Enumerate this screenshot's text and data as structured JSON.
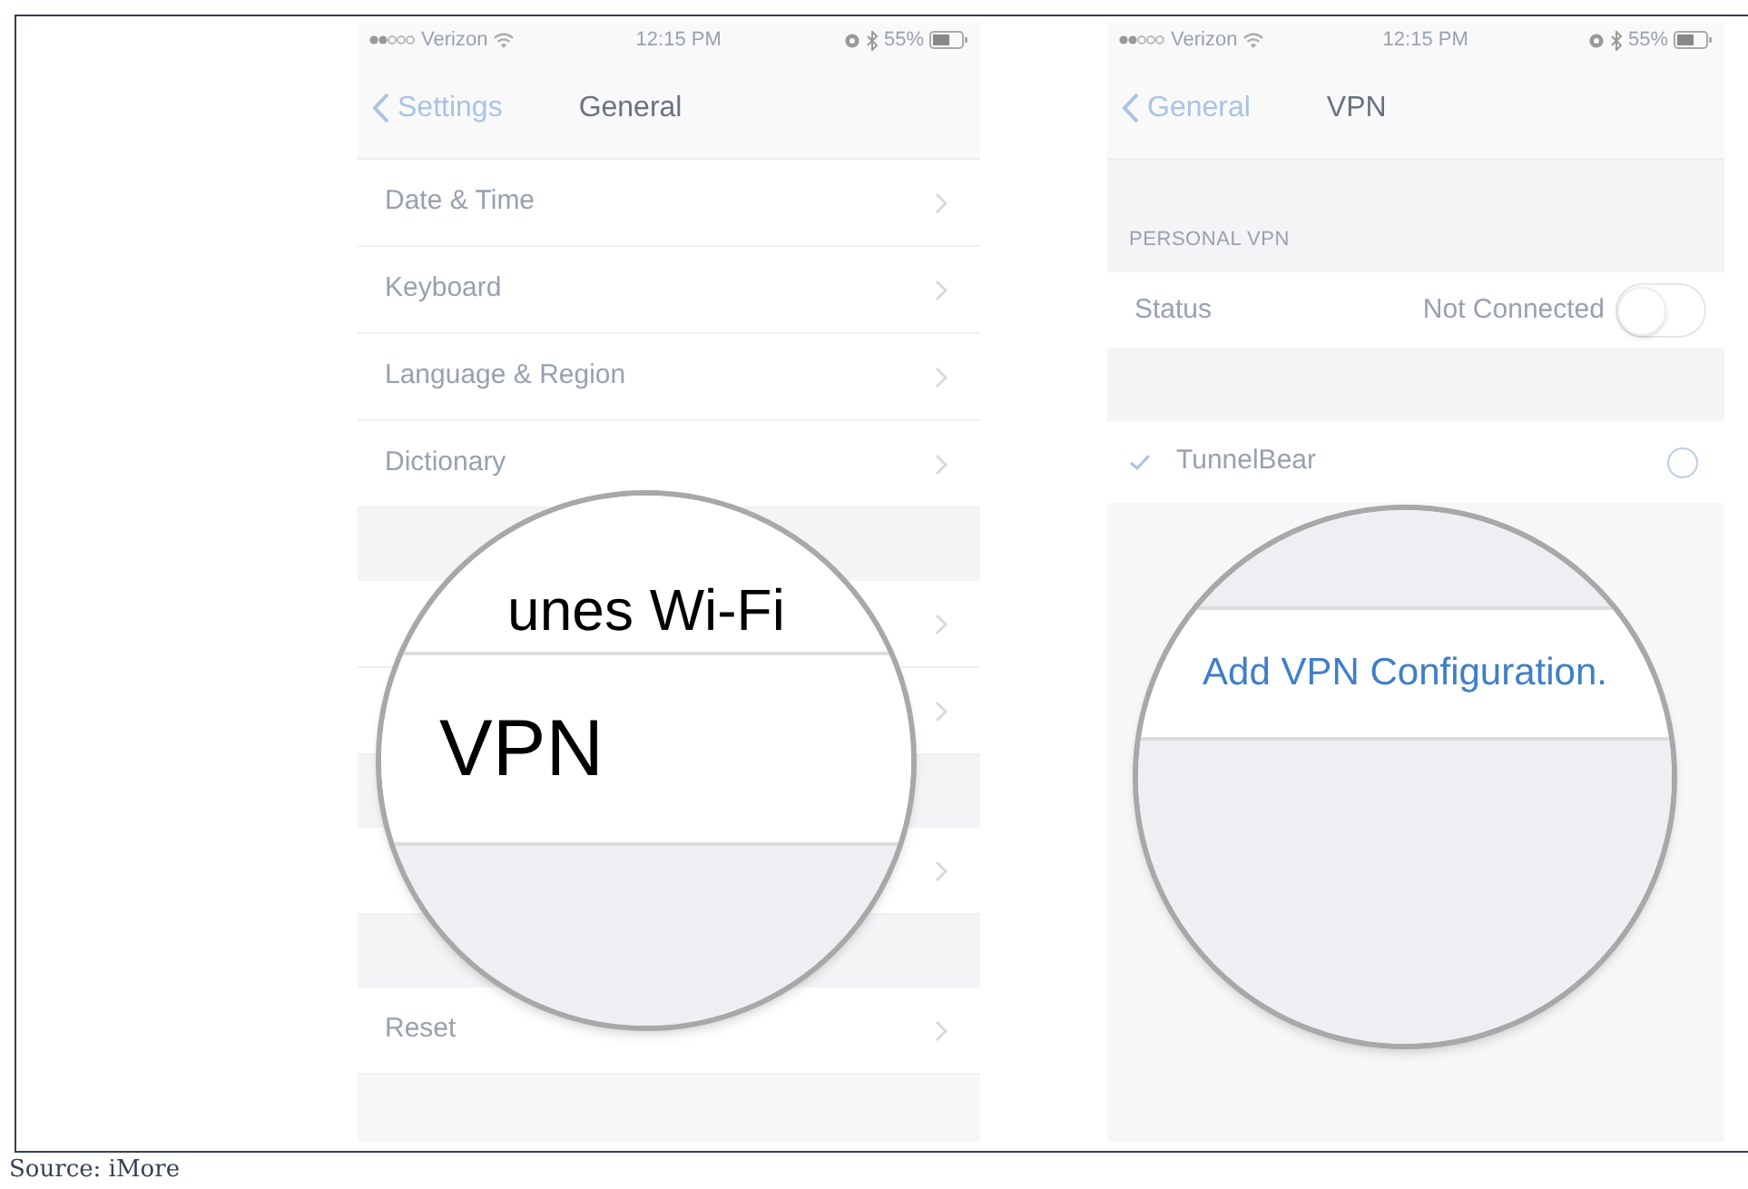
{
  "screens": [
    {
      "status_bar": {
        "carrier": "Verizon",
        "time": "12:15 PM",
        "battery": "55%"
      },
      "nav": {
        "back": "Settings",
        "title": "General"
      },
      "rows": [
        {
          "kind": "row",
          "label": "Date & Time"
        },
        {
          "kind": "row",
          "label": "Keyboard"
        },
        {
          "kind": "row",
          "label": "Language & Region"
        },
        {
          "kind": "row",
          "label": "Dictionary"
        },
        {
          "kind": "gap"
        },
        {
          "kind": "row"
        },
        {
          "kind": "row"
        },
        {
          "kind": "gap"
        },
        {
          "kind": "row"
        },
        {
          "kind": "gap"
        },
        {
          "kind": "row",
          "label": "Reset"
        }
      ],
      "magnifier": {
        "top_text": "unes Wi-Fi",
        "main_text": "VPN",
        "kind": "setting"
      }
    },
    {
      "status_bar": {
        "carrier": "Verizon",
        "time": "12:15 PM",
        "battery": "55%"
      },
      "nav": {
        "back": "General",
        "title": "VPN"
      },
      "rows": [
        {
          "kind": "header",
          "label": "PERSONAL VPN"
        },
        {
          "kind": "toggle",
          "label": "Status",
          "value": "Not Connected",
          "on": false
        },
        {
          "kind": "gap"
        },
        {
          "kind": "config",
          "label": "TunnelBear",
          "checked": true
        }
      ],
      "magnifier": {
        "main_text": "Add VPN Configuration.",
        "kind": "link"
      }
    }
  ],
  "caption": "Source: iMore"
}
